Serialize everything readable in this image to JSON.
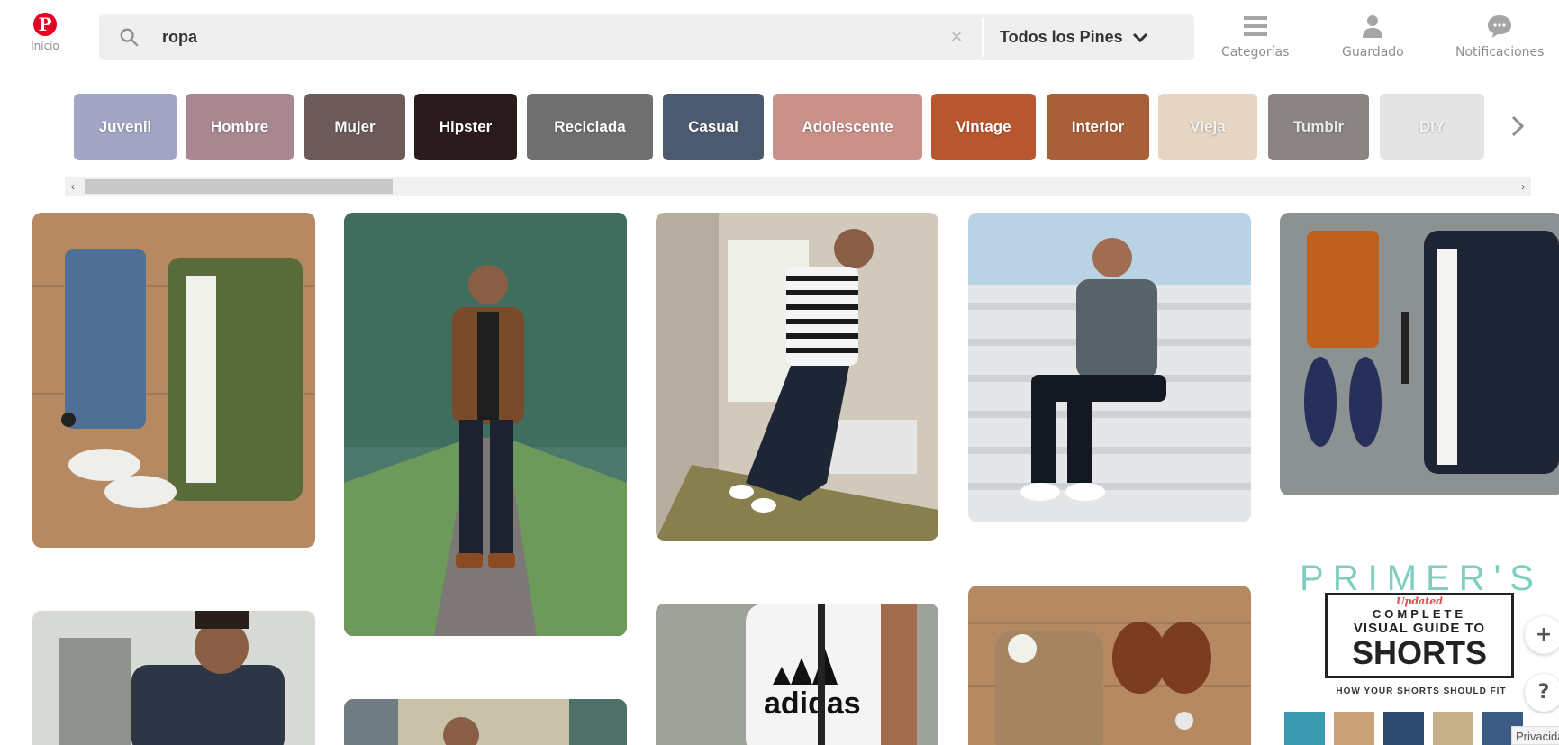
{
  "header": {
    "home_label": "Inicio",
    "search_value": "ropa",
    "search_clear": "×",
    "scope_label": "Todos los Pines",
    "nav": [
      {
        "label": "Categorías",
        "icon": "menu-icon"
      },
      {
        "label": "Guardado",
        "icon": "user-icon"
      },
      {
        "label": "Notificaciones",
        "icon": "chat-bubble-icon"
      }
    ]
  },
  "categories": [
    "Juvenil",
    "Hombre",
    "Mujer",
    "Hipster",
    "Reciclada",
    "Casual",
    "Adolescente",
    "Vintage",
    "Interior",
    "Vieja",
    "Tumblr",
    "DIY"
  ],
  "chip_colors": [
    "#a2a6c4",
    "#a98791",
    "#6d5a5b",
    "#2a1b1c",
    "#6f6f6f",
    "#4c5a70",
    "#c9918a",
    "#b8562f",
    "#a9603a",
    "#e5d5c2",
    "#8a8583",
    "#e4e4e4"
  ],
  "scrollbar": {
    "left": "‹",
    "right": "›"
  },
  "pins": {
    "primer": {
      "title": "PRIMER'S",
      "updated": "Updated",
      "complete": "COMPLETE",
      "visual_guide": "VISUAL GUIDE TO",
      "shorts": "SHORTS",
      "subtitle": "HOW YOUR SHORTS SHOULD FIT"
    },
    "adidas_text": "adidas"
  },
  "floating": {
    "add": "+",
    "help": "?"
  },
  "privacy": "Privacidad"
}
